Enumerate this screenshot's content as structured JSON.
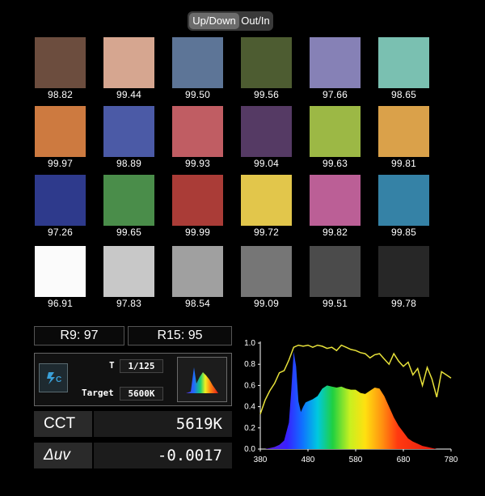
{
  "mode_toggle": {
    "options": [
      "Up/Down",
      "Out/In"
    ],
    "selected": "Up/Down"
  },
  "swatches": [
    {
      "color": "#6c4d3e",
      "value": "98.82"
    },
    {
      "color": "#d6a690",
      "value": "99.44"
    },
    {
      "color": "#5d7597",
      "value": "99.50"
    },
    {
      "color": "#4d5c31",
      "value": "99.56"
    },
    {
      "color": "#8681b6",
      "value": "97.66"
    },
    {
      "color": "#7ac0b1",
      "value": "98.65"
    },
    {
      "color": "#cd7a40",
      "value": "99.97"
    },
    {
      "color": "#4b5aa6",
      "value": "98.89"
    },
    {
      "color": "#c05d63",
      "value": "99.93"
    },
    {
      "color": "#553a64",
      "value": "99.04"
    },
    {
      "color": "#9cb845",
      "value": "99.63"
    },
    {
      "color": "#daa14a",
      "value": "99.81"
    },
    {
      "color": "#2e3a8c",
      "value": "97.26"
    },
    {
      "color": "#4a8d4a",
      "value": "99.65"
    },
    {
      "color": "#aa3c37",
      "value": "99.99"
    },
    {
      "color": "#e2c64b",
      "value": "99.72"
    },
    {
      "color": "#bb5f96",
      "value": "99.82"
    },
    {
      "color": "#3582a6",
      "value": "99.85"
    },
    {
      "color": "#fbfbfb",
      "value": "96.91"
    },
    {
      "color": "#c8c8c8",
      "value": "97.83"
    },
    {
      "color": "#a0a0a0",
      "value": "98.54"
    },
    {
      "color": "#767676",
      "value": "99.09"
    },
    {
      "color": "#4b4b4b",
      "value": "99.51"
    },
    {
      "color": "#272727",
      "value": "99.78"
    }
  ],
  "r_values": {
    "r9": "R9: 97",
    "r15": "R15: 95"
  },
  "settings": {
    "shutter_icon": "shutter-auto-icon",
    "t_label": "T",
    "t_value": "1/125",
    "target_label": "Target",
    "target_value": "5600K"
  },
  "cct": {
    "label": "CCT",
    "value": "5619K"
  },
  "duv": {
    "label": "Δuv",
    "value": "-0.0017"
  },
  "chart_data": {
    "type": "area",
    "x_ticks": [
      380,
      480,
      580,
      680,
      780
    ],
    "y_ticks": [
      "0.0",
      "0.2",
      "0.4",
      "0.6",
      "0.8",
      "1.0"
    ],
    "xlim": [
      380,
      780
    ],
    "ylim": [
      0,
      1.0
    ],
    "series": [
      {
        "x": [
          380,
          390,
          400,
          410,
          420,
          430,
          440,
          445,
          450,
          455,
          460,
          465,
          470,
          475,
          480,
          490,
          500,
          510,
          520,
          530,
          540,
          550,
          560,
          570,
          580,
          590,
          600,
          610,
          620,
          630,
          640,
          650,
          660,
          670,
          680,
          690,
          700,
          710,
          720,
          730,
          740,
          750,
          760,
          770,
          780
        ],
        "values": [
          0.0,
          0.0,
          0.01,
          0.02,
          0.04,
          0.08,
          0.25,
          0.55,
          0.92,
          0.78,
          0.45,
          0.35,
          0.4,
          0.44,
          0.45,
          0.47,
          0.5,
          0.57,
          0.6,
          0.59,
          0.58,
          0.59,
          0.57,
          0.56,
          0.56,
          0.53,
          0.52,
          0.55,
          0.58,
          0.57,
          0.5,
          0.4,
          0.3,
          0.22,
          0.16,
          0.1,
          0.07,
          0.05,
          0.03,
          0.02,
          0.01,
          0.0,
          0.0,
          0.0,
          0.0
        ]
      },
      {
        "color": "#e8e23a",
        "x": [
          380,
          390,
          400,
          410,
          420,
          430,
          440,
          450,
          460,
          470,
          480,
          490,
          500,
          510,
          520,
          530,
          540,
          550,
          560,
          570,
          580,
          590,
          600,
          610,
          620,
          630,
          640,
          650,
          660,
          670,
          680,
          690,
          700,
          710,
          720,
          730,
          740,
          750,
          760,
          770,
          780
        ],
        "values": [
          0.33,
          0.46,
          0.55,
          0.62,
          0.72,
          0.74,
          0.84,
          0.96,
          0.98,
          0.97,
          0.98,
          0.96,
          0.98,
          0.97,
          0.95,
          0.96,
          0.93,
          0.98,
          0.96,
          0.94,
          0.93,
          0.91,
          0.9,
          0.86,
          0.89,
          0.9,
          0.85,
          0.8,
          0.9,
          0.83,
          0.78,
          0.82,
          0.7,
          0.76,
          0.6,
          0.77,
          0.66,
          0.49,
          0.73,
          0.7,
          0.67
        ]
      }
    ]
  }
}
